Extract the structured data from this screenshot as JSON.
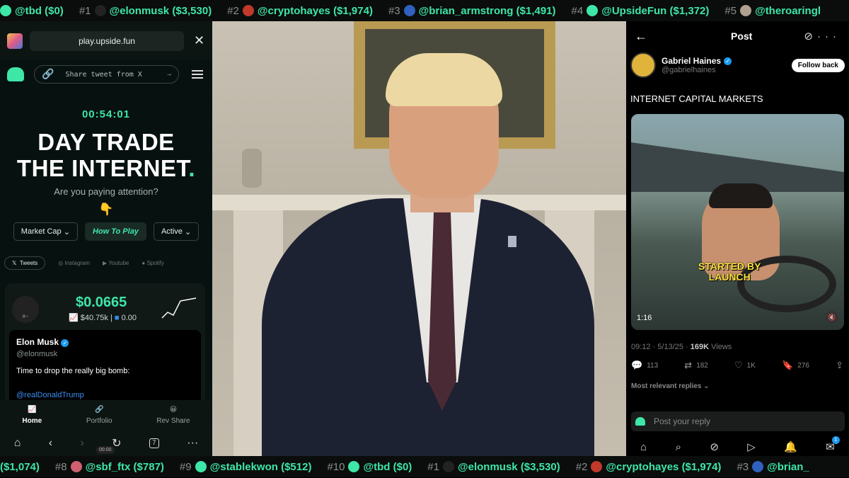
{
  "ticker_top": [
    {
      "rank": "",
      "handle": "@tbd",
      "amount": "($0)",
      "icon": "ghost-icon",
      "color": "#3ee6a8"
    },
    {
      "rank": "#1",
      "handle": "@elonmusk",
      "amount": "($3,530)",
      "icon": "avatar",
      "color": "#222222"
    },
    {
      "rank": "#2",
      "handle": "@cryptohayes",
      "amount": "($1,974)",
      "icon": "avatar",
      "color": "#c0392b"
    },
    {
      "rank": "#3",
      "handle": "@brian_armstrong",
      "amount": "($1,491)",
      "icon": "avatar",
      "color": "#3060c0"
    },
    {
      "rank": "#4",
      "handle": "@UpsideFun",
      "amount": "($1,372)",
      "icon": "ghost-icon",
      "color": "#3ee6a8"
    },
    {
      "rank": "#5",
      "handle": "@theroaringl",
      "amount": "",
      "icon": "avatar",
      "color": "#b0a090"
    }
  ],
  "ticker_bottom": [
    {
      "rank": "",
      "handle": "",
      "amount": "($1,074)",
      "icon": "",
      "color": ""
    },
    {
      "rank": "#8",
      "handle": "@sbf_ftx",
      "amount": "($787)",
      "icon": "avatar",
      "color": "#d06070"
    },
    {
      "rank": "#9",
      "handle": "@stablekwon",
      "amount": "($512)",
      "icon": "ghost-icon",
      "color": "#3ee6a8"
    },
    {
      "rank": "#10",
      "handle": "@tbd",
      "amount": "($0)",
      "icon": "ghost-icon",
      "color": "#3ee6a8"
    },
    {
      "rank": "#1",
      "handle": "@elonmusk",
      "amount": "($3,530)",
      "icon": "avatar",
      "color": "#222222"
    },
    {
      "rank": "#2",
      "handle": "@cryptohayes",
      "amount": "($1,974)",
      "icon": "avatar",
      "color": "#c0392b"
    },
    {
      "rank": "#3",
      "handle": "@brian_",
      "amount": "",
      "icon": "avatar",
      "color": "#3060c0"
    }
  ],
  "left": {
    "url": "play.upside.fun",
    "share_label": "Share tweet from X",
    "timer": "00:54:01",
    "hero_line1": "DAY TRADE",
    "hero_line2": "THE INTERNET",
    "hero_dot": ".",
    "subtitle": "Are you paying attention?",
    "emoji": "👇",
    "filters": {
      "market_cap": "Market Cap",
      "how_to_play": "How To Play",
      "active": "Active"
    },
    "social_tabs": [
      "Tweets",
      "Instagram",
      "Youtube",
      "Spotify"
    ],
    "card": {
      "price": "$0.0665",
      "market_cap": "$40.75k",
      "holders": "0.00",
      "avatar_label": "#--",
      "tweet_name": "Elon Musk",
      "tweet_handle": "@elonmusk",
      "tweet_text": "Time to drop the really big bomb:",
      "tweet_mention": "@realDonaldTrump"
    },
    "bottom_nav": [
      "Home",
      "Portfolio",
      "Rev Share"
    ],
    "browser_tab_count": "7",
    "mini_time": "00:00"
  },
  "right": {
    "title": "Post",
    "author_name": "Gabriel Haines",
    "author_handle": "@gabrielhaines",
    "follow_label": "Follow back",
    "post_text": "INTERNET CAPITAL MARKETS",
    "video_caption_line1": "STARTED BY",
    "video_caption_line2": "LAUNCH",
    "video_duration": "1:16",
    "post_time": "09:12 · 5/13/25 · ",
    "views_count": "169K",
    "views_label": " Views",
    "replies": "113",
    "reposts": "182",
    "likes": "1K",
    "bookmarks": "276",
    "relevant_label": "Most relevant replies ⌄",
    "reply_placeholder": "Post your reply",
    "notif_count": "1"
  },
  "colors": {
    "accent": "#3ee6a8",
    "link": "#3b8ef0",
    "verified": "#1d9bf0"
  }
}
